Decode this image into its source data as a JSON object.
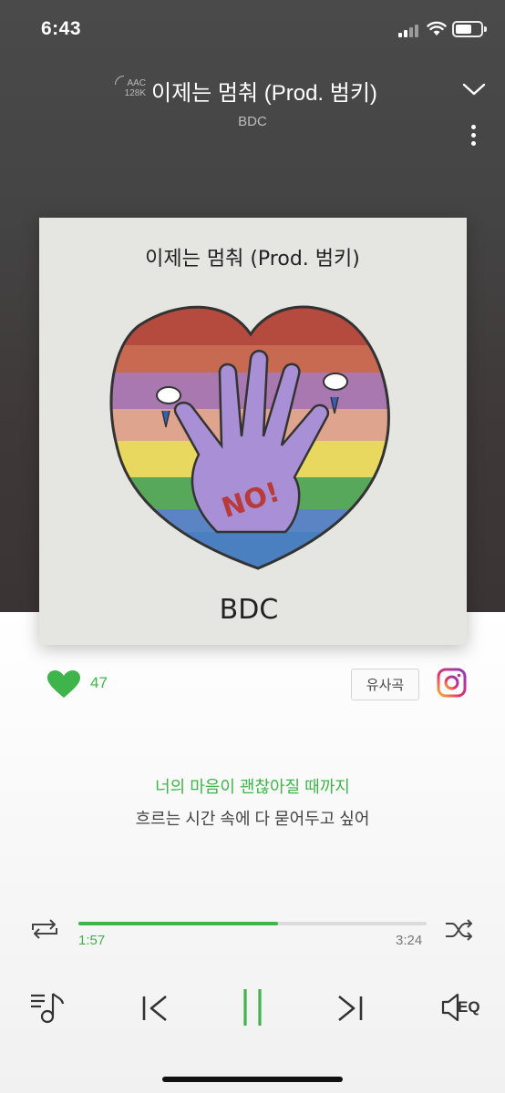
{
  "status_bar": {
    "time": "6:43"
  },
  "header": {
    "quality_badge_top": "AAC",
    "quality_badge_bottom": "128K",
    "title": "이제는 멈춰 (Prod. 범키)",
    "artist": "BDC"
  },
  "album_art": {
    "handwritten_title": "이제는 멈춰 (Prod. 범키)",
    "hand_text": "NO!",
    "artist_text": "BDC"
  },
  "actions": {
    "like_count": "47",
    "similar_songs_label": "유사곡"
  },
  "lyrics": {
    "current": "너의 마음이 괜찮아질 때까지",
    "next": "흐르는 시간 속에 다 묻어두고 싶어"
  },
  "playback": {
    "elapsed": "1:57",
    "total": "3:24",
    "progress_fraction": 0.574
  },
  "controls": {
    "eq_label": "EQ"
  },
  "colors": {
    "accent": "#3fb44a",
    "header_bg": "#454545"
  }
}
